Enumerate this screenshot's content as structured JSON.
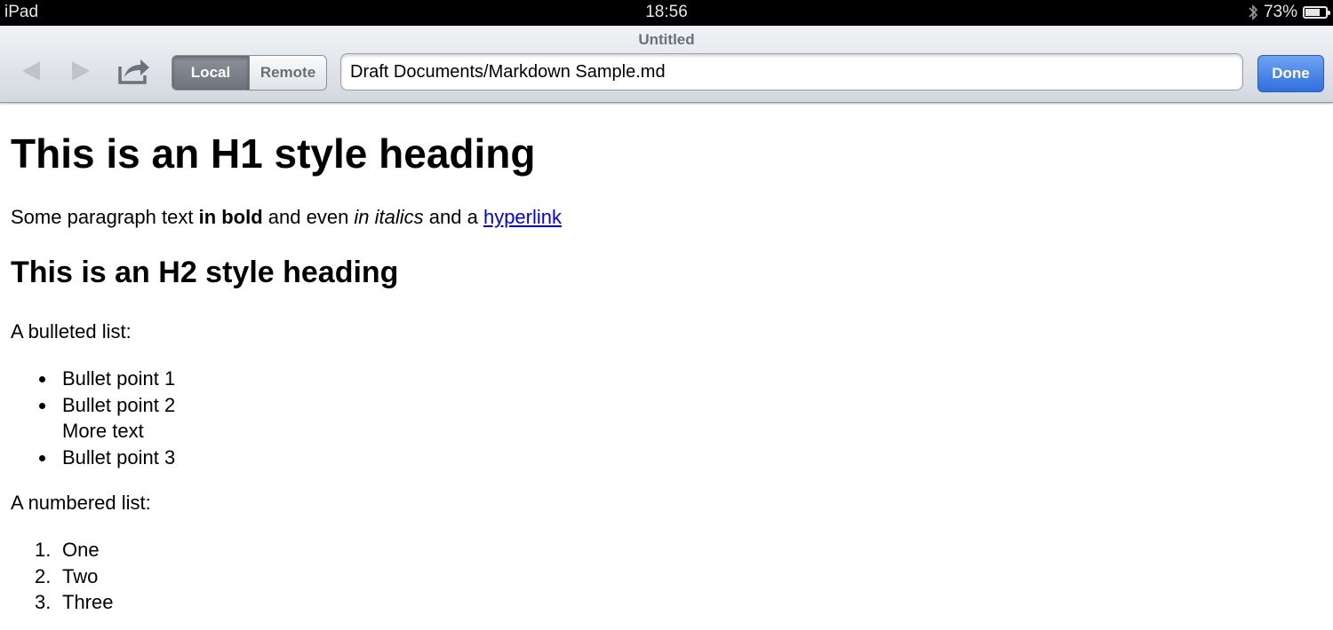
{
  "status_bar": {
    "device": "iPad",
    "time": "18:56",
    "battery": "73%",
    "battery_level": 0.73
  },
  "toolbar": {
    "title": "Untitled",
    "segments": {
      "local": "Local",
      "remote": "Remote",
      "selected": "Local"
    },
    "path_value": "Draft Documents/Markdown Sample.md",
    "done_label": "Done"
  },
  "content": {
    "h1": "This is an H1 style heading",
    "paragraph": {
      "text_1": "Some paragraph text ",
      "bold": "in bold",
      "text_2": " and even ",
      "italic": "in italics",
      "text_3": " and a ",
      "link": "hyperlink"
    },
    "h2": "This is an H2 style heading",
    "bulleted_intro": "A bulleted list:",
    "bullets": [
      "Bullet point 1",
      "Bullet point 2",
      "Bullet point 3"
    ],
    "bullet_2_extra": "More text",
    "numbered_intro": "A numbered list:",
    "numbered_markers": [
      "1.",
      "2.",
      "3."
    ],
    "numbered": [
      "One",
      "Two",
      "Three"
    ]
  }
}
